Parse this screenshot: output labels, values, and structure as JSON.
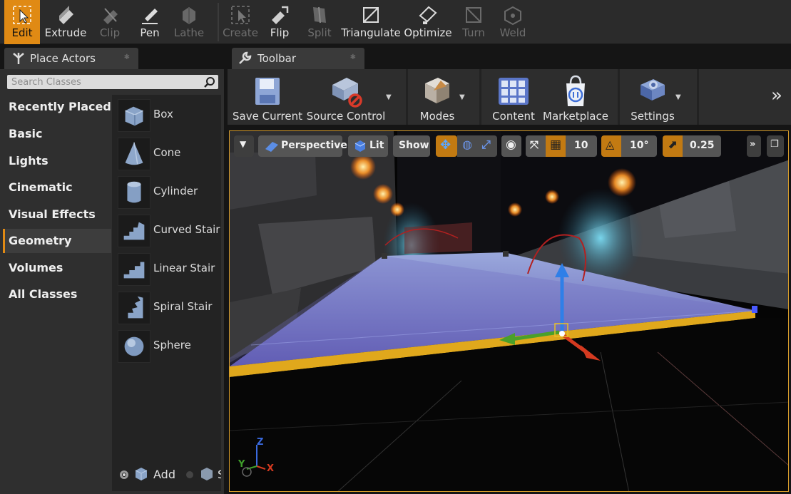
{
  "geometry_toolbar": {
    "tools": [
      {
        "label": "Edit",
        "icon": "edit-cursor-icon",
        "state": "active"
      },
      {
        "label": "Extrude",
        "icon": "extrude-icon",
        "state": "enabled"
      },
      {
        "label": "Clip",
        "icon": "clip-icon",
        "state": "disabled"
      },
      {
        "label": "Pen",
        "icon": "pen-icon",
        "state": "enabled"
      },
      {
        "label": "Lathe",
        "icon": "lathe-icon",
        "state": "disabled"
      },
      {
        "label": "Create",
        "icon": "create-icon",
        "state": "disabled"
      },
      {
        "label": "Flip",
        "icon": "flip-icon",
        "state": "enabled"
      },
      {
        "label": "Split",
        "icon": "split-icon",
        "state": "disabled"
      },
      {
        "label": "Triangulate",
        "icon": "triangulate-icon",
        "state": "enabled"
      },
      {
        "label": "Optimize",
        "icon": "optimize-icon",
        "state": "enabled"
      },
      {
        "label": "Turn",
        "icon": "turn-icon",
        "state": "disabled"
      },
      {
        "label": "Weld",
        "icon": "weld-icon",
        "state": "disabled"
      }
    ]
  },
  "tabs": {
    "place_actors": {
      "label": "Place Actors",
      "icon": "place-actors-icon"
    },
    "toolbar": {
      "label": "Toolbar",
      "icon": "toolbar-wrench-icon"
    }
  },
  "place_actors": {
    "search_placeholder": "Search Classes",
    "categories": [
      {
        "label": "Recently Placed"
      },
      {
        "label": "Basic"
      },
      {
        "label": "Lights"
      },
      {
        "label": "Cinematic"
      },
      {
        "label": "Visual Effects"
      },
      {
        "label": "Geometry",
        "selected": true
      },
      {
        "label": "Volumes"
      },
      {
        "label": "All Classes"
      }
    ],
    "actors": [
      {
        "label": "Box",
        "icon": "box-brush-icon"
      },
      {
        "label": "Cone",
        "icon": "cone-brush-icon"
      },
      {
        "label": "Cylinder",
        "icon": "cylinder-brush-icon"
      },
      {
        "label": "Curved Stair",
        "icon": "curved-stair-icon"
      },
      {
        "label": "Linear Stair",
        "icon": "linear-stair-icon"
      },
      {
        "label": "Spiral Stair",
        "icon": "spiral-stair-icon"
      },
      {
        "label": "Sphere",
        "icon": "sphere-brush-icon"
      }
    ],
    "brush_type": {
      "add_label": "Add",
      "subtract_label": "S",
      "selected": "Add"
    }
  },
  "main_toolbar": {
    "buttons": [
      {
        "label": "Save Current",
        "icon": "save-icon"
      },
      {
        "label": "Source Control",
        "icon": "source-control-icon"
      },
      {
        "label": "Modes",
        "icon": "modes-icon"
      },
      {
        "label": "Content",
        "icon": "content-icon"
      },
      {
        "label": "Marketplace",
        "icon": "marketplace-icon"
      },
      {
        "label": "Settings",
        "icon": "settings-icon"
      }
    ]
  },
  "viewport": {
    "view_mode": "Perspective",
    "lighting_mode": "Lit",
    "show_label": "Show",
    "grid_snap": "10",
    "rotation_snap": "10°",
    "scale_snap": "0.25",
    "axis_labels": {
      "x": "X",
      "y": "Y",
      "z": "Z"
    },
    "accent_color": "#e08a14"
  }
}
